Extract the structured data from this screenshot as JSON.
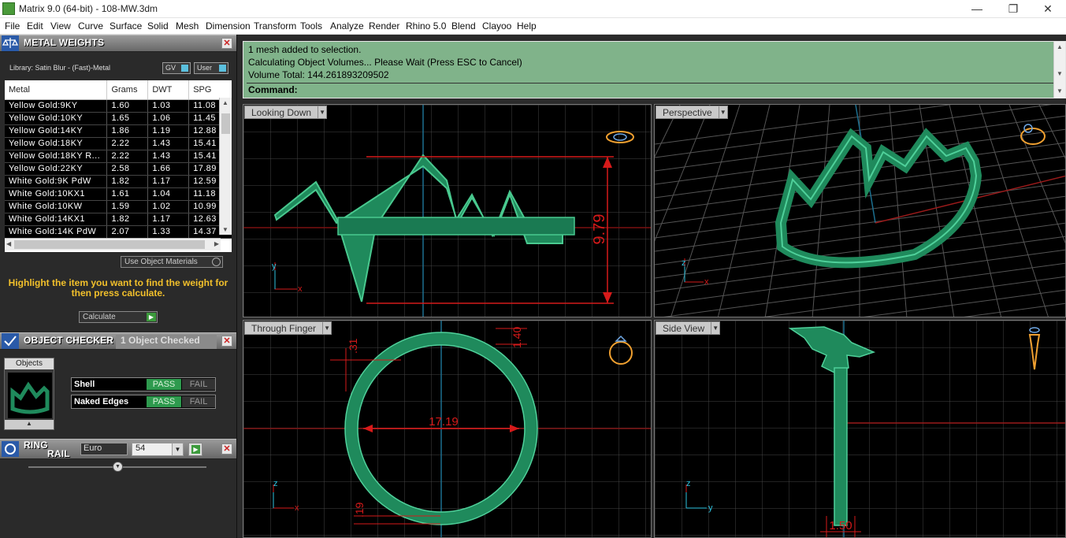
{
  "window": {
    "title": "Matrix 9.0 (64-bit) - 108-MW.3dm",
    "minimize": "—",
    "maximize": "❐",
    "close": "✕"
  },
  "menu": [
    "File",
    "Edit",
    "View",
    "Curve",
    "Surface",
    "Solid",
    "Mesh",
    "Dimension",
    "Transform",
    "Tools",
    "Analyze",
    "Render",
    "Rhino 5.0",
    "Blend",
    "Clayoo",
    "Help"
  ],
  "metal_weights": {
    "title": "METAL WEIGHTS",
    "library": "Library: Satin Blur - (Fast)-Metal",
    "toggle_gv": "GV",
    "toggle_user": "User",
    "columns": [
      "Metal",
      "Grams",
      "DWT",
      "SPG"
    ],
    "rows": [
      [
        "Yellow Gold:9KY",
        "1.60",
        "1.03",
        "11.08"
      ],
      [
        "Yellow Gold:10KY",
        "1.65",
        "1.06",
        "11.45"
      ],
      [
        "Yellow Gold:14KY",
        "1.86",
        "1.19",
        "12.88"
      ],
      [
        "Yellow Gold:18KY",
        "2.22",
        "1.43",
        "15.41"
      ],
      [
        "Yellow Gold:18KY R...",
        "2.22",
        "1.43",
        "15.41"
      ],
      [
        "Yellow Gold:22KY",
        "2.58",
        "1.66",
        "17.89"
      ],
      [
        "White Gold:9K PdW",
        "1.82",
        "1.17",
        "12.59"
      ],
      [
        "White Gold:10KX1",
        "1.61",
        "1.04",
        "11.18"
      ],
      [
        "White Gold:10KW",
        "1.59",
        "1.02",
        "10.99"
      ],
      [
        "White Gold:14KX1",
        "1.82",
        "1.17",
        "12.63"
      ],
      [
        "White Gold:14K PdW",
        "2.07",
        "1.33",
        "14.37"
      ]
    ],
    "use_object_materials": "Use Object Materials",
    "hint": "Highlight the item you want to find the weight for then press calculate.",
    "calculate": "Calculate"
  },
  "object_checker": {
    "title": "OBJECT CHECKER",
    "status": "1  Object Checked",
    "objects_label": "Objects",
    "checks": [
      {
        "label": "Shell",
        "pass": "PASS",
        "fail": "FAIL"
      },
      {
        "label": "Naked Edges",
        "pass": "PASS",
        "fail": "FAIL"
      }
    ]
  },
  "ring_rail": {
    "title_1": "RING",
    "title_2": "RAIL",
    "standard": "Euro",
    "size": "54"
  },
  "command": {
    "lines": [
      "1 mesh added to selection.",
      "Calculating Object Volumes... Please Wait (Press ESC to Cancel)",
      "Volume Total: 144.261893209502"
    ],
    "prompt": "Command:"
  },
  "viewports": {
    "top_left": {
      "name": "Looking Down",
      "dimension": "9.79",
      "axis_a": "y",
      "axis_b": "x"
    },
    "top_right": {
      "name": "Perspective",
      "axis_a": "z",
      "axis_b": "x"
    },
    "bottom_left": {
      "name": "Through Finger",
      "dim_inner": "17.19",
      "dim_top": "1.40",
      "dim_left": ".31",
      "dim_bottom": ".19",
      "axis_a": "z",
      "axis_b": "x"
    },
    "bottom_right": {
      "name": "Side View",
      "dim_bottom": "1.50",
      "axis_a": "z",
      "axis_b": "y"
    }
  },
  "colors": {
    "ring": "#1f8a5c",
    "dimension": "#d61a1a",
    "command_bg": "#80b38a",
    "panel_accent": "#f2c02b"
  }
}
